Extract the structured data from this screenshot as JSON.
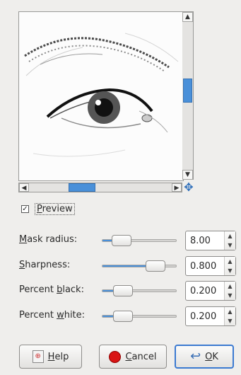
{
  "preview": {
    "label": "Preview",
    "checked": true,
    "checkmark": "✓"
  },
  "scroll": {
    "up": "▲",
    "down": "▼",
    "left": "◀",
    "right": "▶",
    "nav": "✥"
  },
  "sliders": [
    {
      "label": "Mask radius:",
      "value": "8.00",
      "level": 0.18,
      "key": "M",
      "rest": "ask radius:"
    },
    {
      "label": "Sharpness:",
      "value": "0.800",
      "level": 0.8,
      "key": "S",
      "rest": "harpness:"
    },
    {
      "label": "Percent black:",
      "value": "0.200",
      "level": 0.2
    },
    {
      "label": "Percent white:",
      "value": "0.200",
      "level": 0.2
    }
  ],
  "spin_arrows": {
    "up": "▲",
    "down": "▼"
  },
  "buttons": {
    "help": {
      "label": "Help",
      "icon": "help-icon"
    },
    "cancel": {
      "label": "Cancel",
      "icon": "cancel-icon"
    },
    "ok": {
      "label": "OK",
      "icon": "ok-icon"
    }
  },
  "colors": {
    "accent": "#4a90d9",
    "cancel_red": "#d91515"
  }
}
